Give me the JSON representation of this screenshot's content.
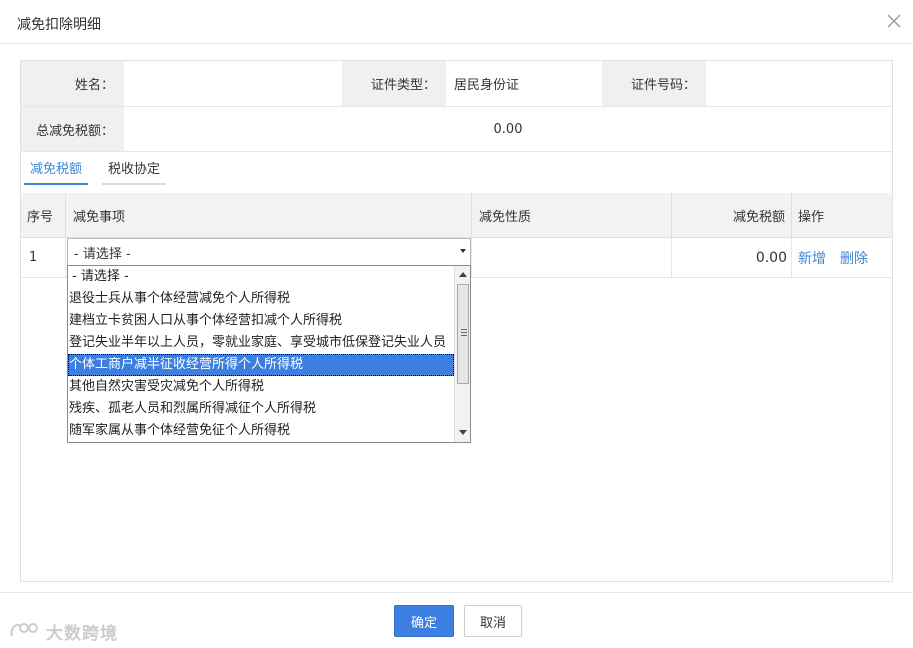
{
  "dialog": {
    "title": "减免扣除明细"
  },
  "info": {
    "name_label": "姓名：",
    "name_value": "",
    "id_type_label": "证件类型：",
    "id_type_value": "居民身份证",
    "id_number_label": "证件号码：",
    "id_number_value": "",
    "total_label": "总减免税额：",
    "total_value": "0.00"
  },
  "tabs": [
    {
      "label": "减免税额",
      "active": true
    },
    {
      "label": "税收协定",
      "active": false
    }
  ],
  "grid": {
    "headers": [
      "序号",
      "减免事项",
      "减免性质",
      "减免税额",
      "操作"
    ],
    "rows": [
      {
        "index": "1",
        "item_selected": "- 请选择 -",
        "nature": "",
        "amount": "0.00",
        "add_label": "新增",
        "delete_label": "删除"
      }
    ]
  },
  "dropdown": {
    "options": [
      "- 请选择 -",
      "退役士兵从事个体经营减免个人所得税",
      "建档立卡贫困人口从事个体经营扣减个人所得税",
      "登记失业半年以上人员，零就业家庭、享受城市低保登记失业人员",
      "个体工商户减半征收经营所得个人所得税",
      "其他自然灾害受灾减免个人所得税",
      "残疾、孤老人员和烈属所得减征个人所得税",
      "随军家属从事个体经营免征个人所得税"
    ],
    "selected_index": 4
  },
  "footer": {
    "confirm_label": "确定",
    "cancel_label": "取消"
  },
  "watermark": {
    "text": "大数跨境"
  },
  "colors": {
    "accent": "#3c87d9",
    "primary_button": "#3c7fe0",
    "label_bg": "#f0f0f0"
  }
}
